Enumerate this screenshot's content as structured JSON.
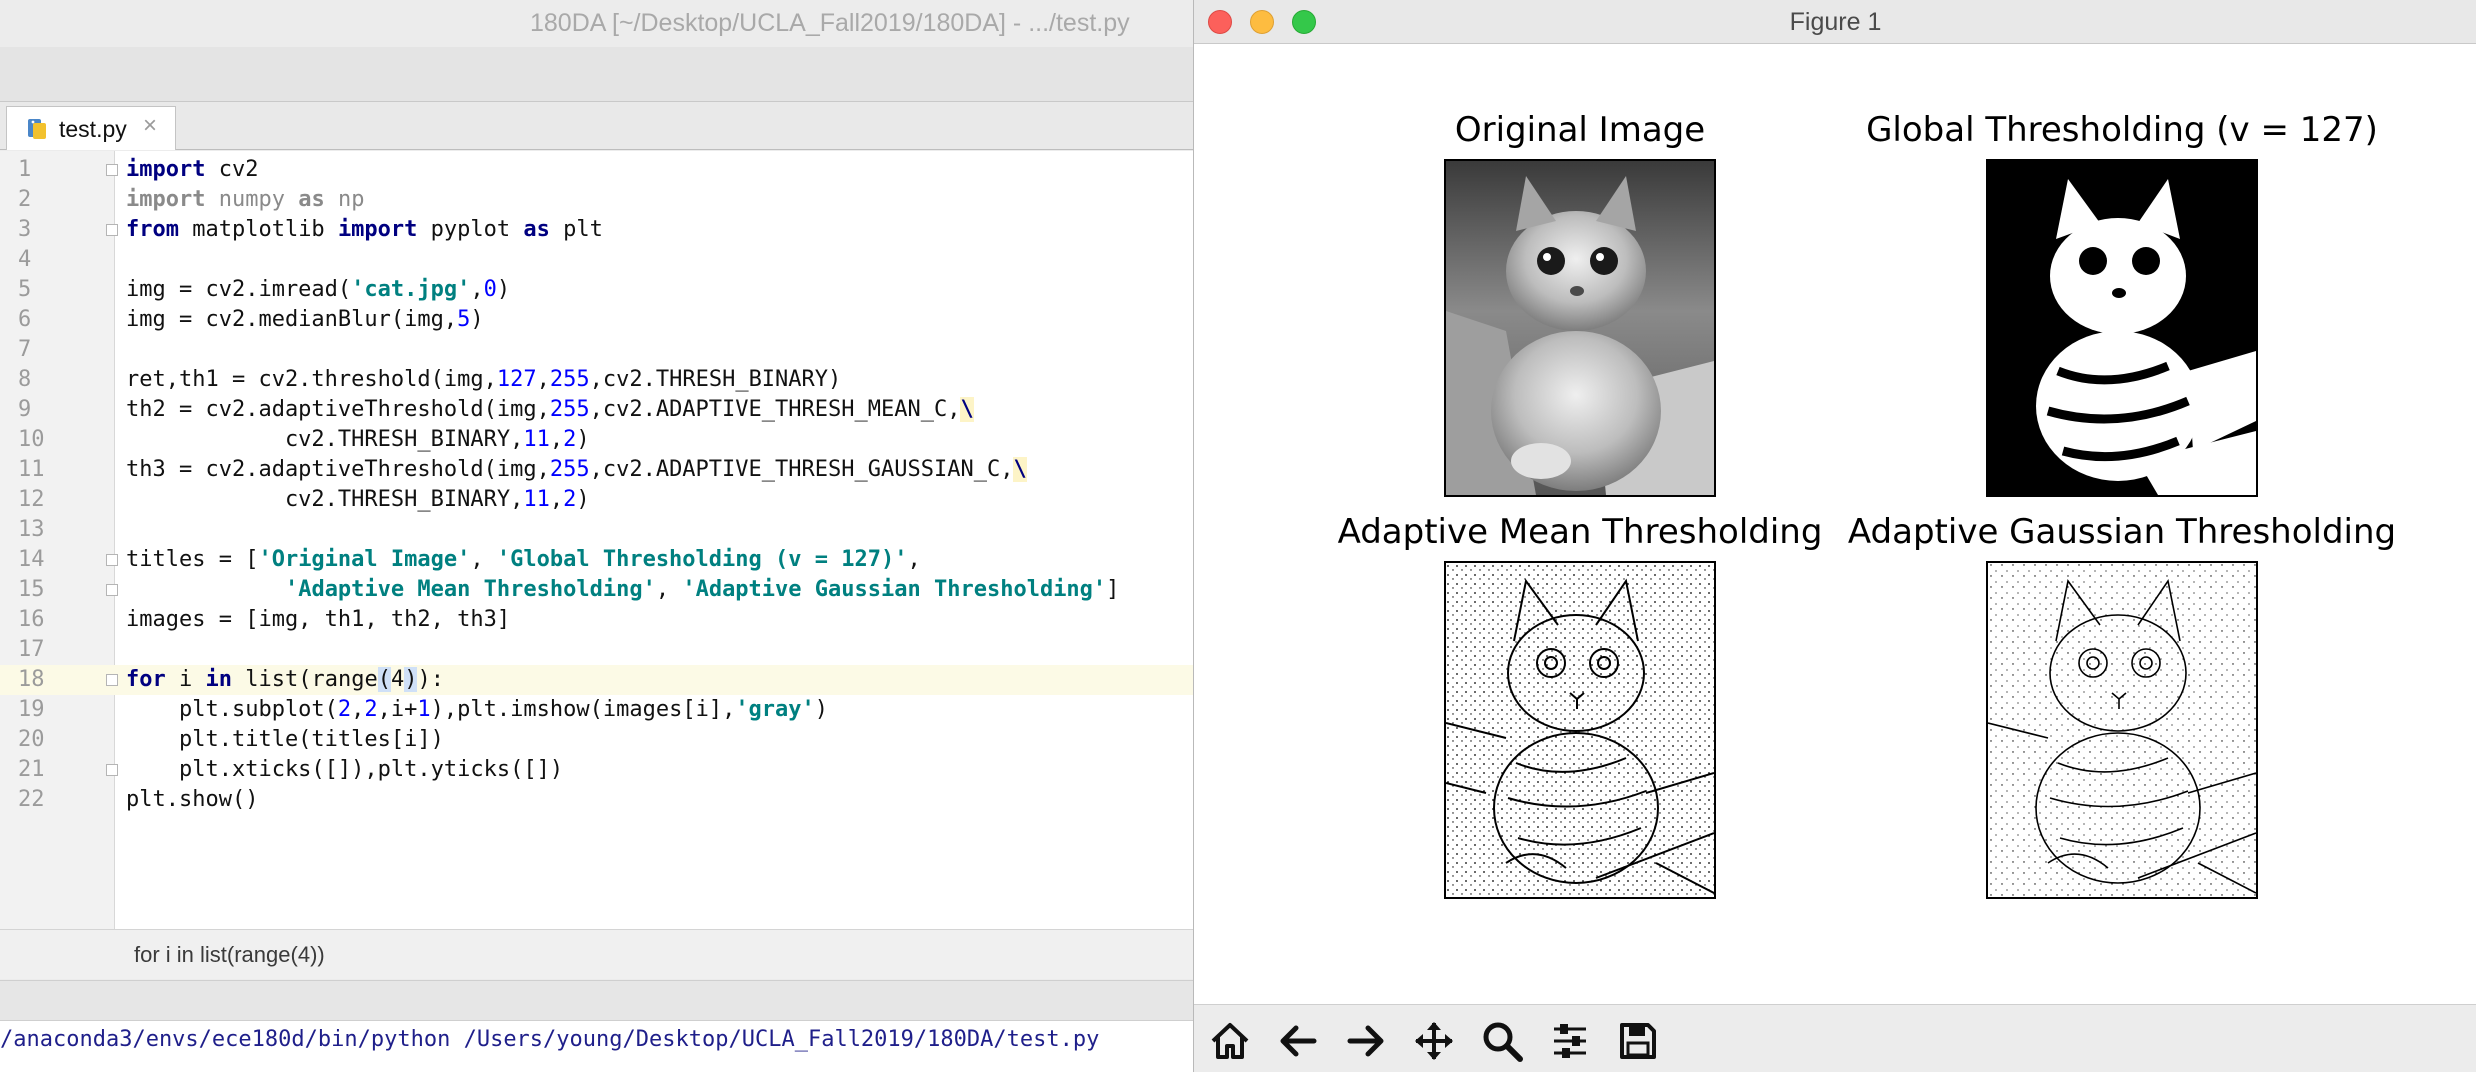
{
  "ide": {
    "window_title": "180DA [~/Desktop/UCLA_Fall2019/180DA] - .../test.py",
    "tab": {
      "label": "test.py",
      "close": "×"
    },
    "code_lines": [
      {
        "n": "1",
        "html": "<span class=\"kw\">import</span> cv2"
      },
      {
        "n": "2",
        "html": "<span class=\"mod\"><span class=\"kw\" style=\"color:#8a8a8a\">import</span> numpy <span class=\"kw\" style=\"color:#8a8a8a\">as</span> np</span>"
      },
      {
        "n": "3",
        "html": "<span class=\"kw\">from</span> matplotlib <span class=\"kw\">import</span> pyplot <span class=\"kw\">as</span> plt"
      },
      {
        "n": "4",
        "html": ""
      },
      {
        "n": "5",
        "html": "img = cv2.imread(<span class=\"str\">'cat.jpg'</span>,<span class=\"num\">0</span>)"
      },
      {
        "n": "6",
        "html": "img = cv2.medianBlur(img,<span class=\"num\">5</span>)"
      },
      {
        "n": "7",
        "html": ""
      },
      {
        "n": "8",
        "html": "ret,th1 = cv2.threshold(img,<span class=\"num\">127</span>,<span class=\"num\">255</span>,cv2.THRESH_BINARY)"
      },
      {
        "n": "9",
        "html": "th2 = cv2.adaptiveThreshold(img,<span class=\"num\">255</span>,cv2.ADAPTIVE_THRESH_MEAN_C,<span class=\"esc\">\\</span>"
      },
      {
        "n": "10",
        "html": "            cv2.THRESH_BINARY,<span class=\"num\">11</span>,<span class=\"num\">2</span>)"
      },
      {
        "n": "11",
        "html": "th3 = cv2.adaptiveThreshold(img,<span class=\"num\">255</span>,cv2.ADAPTIVE_THRESH_GAUSSIAN_C,<span class=\"esc\">\\</span>"
      },
      {
        "n": "12",
        "html": "            cv2.THRESH_BINARY,<span class=\"num\">11</span>,<span class=\"num\">2</span>)"
      },
      {
        "n": "13",
        "html": ""
      },
      {
        "n": "14",
        "html": "titles = [<span class=\"str\">'Original Image'</span>, <span class=\"str\">'Global Thresholding (v = 127)'</span>,"
      },
      {
        "n": "15",
        "html": "            <span class=\"str\">'Adaptive Mean Thresholding'</span>, <span class=\"str\">'Adaptive Gaussian Thresholding'</span>]"
      },
      {
        "n": "16",
        "html": "images = [img, th1, th2, th3]"
      },
      {
        "n": "17",
        "html": ""
      },
      {
        "n": "18",
        "html": "<span class=\"kw\">for</span> i <span class=\"kw\">in</span> list(range<span class=\"hl\">(</span>4<span class=\"hl\">)</span>):"
      },
      {
        "n": "19",
        "html": "    plt.subplot(<span class=\"num\">2</span>,<span class=\"num\">2</span>,i+<span class=\"num\">1</span>),plt.imshow(images[i],<span class=\"str\">'gray'</span>)"
      },
      {
        "n": "20",
        "html": "    plt.title(titles[i])"
      },
      {
        "n": "21",
        "html": "    plt.xticks([]),plt.yticks([])"
      },
      {
        "n": "22",
        "html": "plt.show()"
      }
    ],
    "current_line": "18",
    "fold_lines": [
      "1",
      "3",
      "14",
      "15",
      "18",
      "21"
    ],
    "breadcrumb": "for i in list(range(4))",
    "console_text": "/anaconda3/envs/ece180d/bin/python /Users/young/Desktop/UCLA_Fall2019/180DA/test.py"
  },
  "figure": {
    "window_title": "Figure 1",
    "subplots": [
      {
        "title": "Original Image",
        "kind": "grayscale"
      },
      {
        "title": "Global Thresholding (v = 127)",
        "kind": "binary"
      },
      {
        "title": "Adaptive Mean Thresholding",
        "kind": "edges"
      },
      {
        "title": "Adaptive Gaussian Thresholding",
        "kind": "edges"
      }
    ],
    "toolbar": [
      "home-icon",
      "back-arrow-icon",
      "forward-arrow-icon",
      "pan-move-icon",
      "zoom-magnifier-icon",
      "configure-subplots-icon",
      "save-floppy-icon"
    ]
  },
  "colors": {
    "keyword": "#000080",
    "string": "#008080",
    "number": "#0000ff",
    "current_line": "#fcfae6",
    "traffic_close": "#fc605b",
    "traffic_min": "#fdbc40",
    "traffic_max": "#34c84a"
  }
}
